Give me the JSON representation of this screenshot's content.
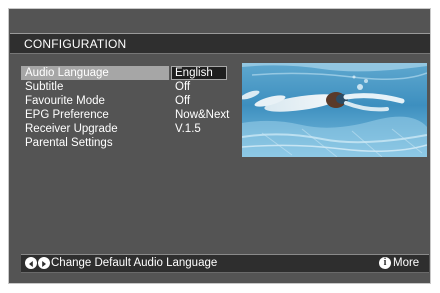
{
  "header": {
    "title": "CONFIGURATION"
  },
  "menu": {
    "items": [
      {
        "label": "Audio Language",
        "value": "English"
      },
      {
        "label": "Subtitle",
        "value": "Off"
      },
      {
        "label": "Favourite Mode",
        "value": "Off"
      },
      {
        "label": "EPG Preference",
        "value": "Now&Next"
      },
      {
        "label": "Receiver Upgrade",
        "value": "V.1.5"
      },
      {
        "label": "Parental Settings",
        "value": ""
      }
    ]
  },
  "preview": {
    "icon": "swimmer-underwater-image"
  },
  "status_bar": {
    "hint": "Change Default Audio Language",
    "more_label": "More",
    "left_icons": [
      "left-arrow-circle-icon",
      "right-arrow-circle-icon"
    ],
    "info_glyph": "i"
  },
  "colors": {
    "background": "#545454",
    "title_bar": "#2f2f2f",
    "selection": "#a6a6a6",
    "text": "#ffffff"
  }
}
